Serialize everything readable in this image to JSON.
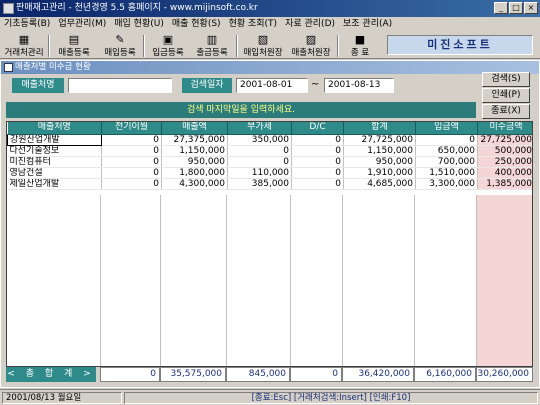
{
  "window": {
    "title": "판매재고관리 - 천년경영 5.5   홈페이지 - www.mijinsoft.co.kr",
    "minimize": "_",
    "maximize": "□",
    "close": "×"
  },
  "menu": [
    "기초등록(B)",
    "업무관리(M)",
    "매입 현황(U)",
    "매출 현황(S)",
    "현황 조회(T)",
    "자료 관리(D)",
    "보조 관리(A)"
  ],
  "toolbar": [
    {
      "label": "거래처관리",
      "icon": "▦"
    },
    {
      "label": "매출등록",
      "icon": "▤"
    },
    {
      "label": "매입등록",
      "icon": "✎"
    },
    {
      "label": "입금등록",
      "icon": "▣"
    },
    {
      "label": "출금등록",
      "icon": "▥"
    },
    {
      "label": "매입처원장",
      "icon": "▧"
    },
    {
      "label": "매출처원장",
      "icon": "▨"
    },
    {
      "label": "종   료",
      "icon": "■"
    }
  ],
  "brand": "미진소프트",
  "child_title": "매출처별 미수금 현황",
  "filter": {
    "customer_label": "매출처명",
    "customer_value": "",
    "date_label": "검색일자",
    "date_from": "2001-08-01",
    "date_sep": "~",
    "date_to": "2001-08-13"
  },
  "buttons": {
    "search": "검색(S)",
    "print": "인쇄(P)",
    "exit": "종료(X)"
  },
  "hint": "검색 마지막일을 입력하세요.",
  "columns": [
    "매출처명",
    "전기이월",
    "매출액",
    "부가세",
    "D/C",
    "합계",
    "입금액",
    "미수금액"
  ],
  "rows": [
    [
      "강원산업개발",
      "0",
      "27,375,000",
      "350,000",
      "0",
      "27,725,000",
      "0",
      "27,725,000"
    ],
    [
      "다선기술정보",
      "0",
      "1,150,000",
      "0",
      "0",
      "1,150,000",
      "650,000",
      "500,000"
    ],
    [
      "미진컴퓨터",
      "0",
      "950,000",
      "0",
      "0",
      "950,000",
      "700,000",
      "250,000"
    ],
    [
      "영남건설",
      "0",
      "1,800,000",
      "110,000",
      "0",
      "1,910,000",
      "1,510,000",
      "400,000"
    ],
    [
      "제일산업개발",
      "0",
      "4,300,000",
      "385,000",
      "0",
      "4,685,000",
      "3,300,000",
      "1,385,000"
    ]
  ],
  "totals": {
    "label": "< 총  합  계 >",
    "values": [
      "0",
      "35,575,000",
      "845,000",
      "0",
      "36,420,000",
      "6,160,000",
      "30,260,000"
    ]
  },
  "status": {
    "date": "2001/08/13 월요일",
    "hints": "[종료:Esc]  [거래처검색:Insert]  [인쇄:F10]"
  }
}
